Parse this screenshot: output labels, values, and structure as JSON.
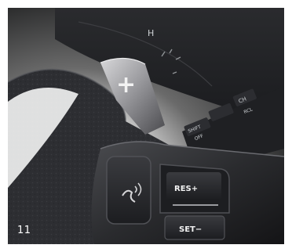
{
  "photo": {
    "caption": "11",
    "paddle_label": "+",
    "buttons": {
      "resume": "RES+",
      "set": "SET−"
    },
    "voice_button_icon": "voice-command-icon",
    "dashboard_text": [
      "H",
      "SHIFT",
      "OFF",
      "CH",
      "RCL"
    ]
  }
}
